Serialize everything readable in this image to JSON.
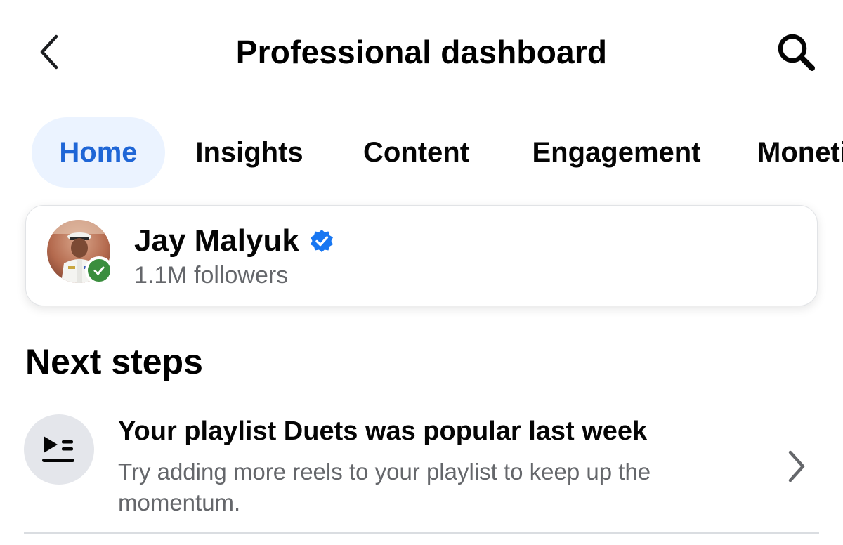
{
  "header": {
    "title": "Professional dashboard",
    "back_icon": "chevron-left-icon",
    "search_icon": "search-icon"
  },
  "tabs": [
    {
      "label": "Home",
      "active": true
    },
    {
      "label": "Insights",
      "active": false
    },
    {
      "label": "Content",
      "active": false
    },
    {
      "label": "Engagement",
      "active": false
    },
    {
      "label": "Monetization",
      "active": false
    }
  ],
  "profile": {
    "name": "Jay Malyuk",
    "followers": "1.1M followers",
    "verified": true,
    "status_badge": "check-badge-icon"
  },
  "next_steps": {
    "title": "Next steps",
    "items": [
      {
        "icon": "playlist-icon",
        "title": "Your playlist Duets was popular last week",
        "description": "Try adding more reels to your playlist to keep up the momentum."
      }
    ]
  },
  "colors": {
    "accent": "#1f66d6",
    "active_tab_bg": "#ebf3ff",
    "verified": "#1877f2",
    "online": "#3a8e3e",
    "secondary_text": "#65676b"
  }
}
